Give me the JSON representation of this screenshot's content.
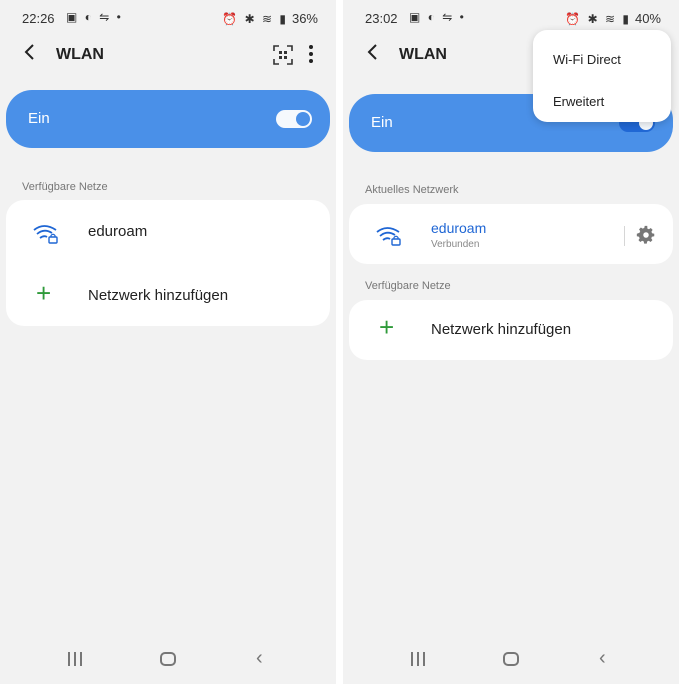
{
  "left": {
    "status": {
      "time": "22:26",
      "left_icons": "▣ ◐ ⇋ •",
      "right_icons": "⏰ ✱ ≋ ▮",
      "battery": "36%"
    },
    "appbar": {
      "title": "WLAN",
      "back_icon": "chevron-left-icon",
      "qr_icon": "qr-scan-icon",
      "more_icon": "more-vert-icon"
    },
    "wifi_toggle": {
      "label": "Ein",
      "on": true
    },
    "available": {
      "label": "Verfügbare Netze",
      "networks": [
        {
          "name": "eduroam",
          "icon": "wifi-lock-icon"
        }
      ],
      "add_label": "Netzwerk hinzufügen"
    },
    "nav": {
      "recents": "recents-icon",
      "home": "home-icon",
      "back": "back-icon"
    }
  },
  "right": {
    "status": {
      "time": "23:02",
      "left_icons": "▣ ◐ ⇋ •",
      "right_icons": "⏰ ✱ ≋ ▮",
      "battery": "40%"
    },
    "appbar": {
      "title": "WLAN",
      "back_icon": "chevron-left-icon"
    },
    "menu": {
      "items": [
        "Wi-Fi Direct",
        "Erweitert"
      ]
    },
    "wifi_toggle": {
      "label": "Ein",
      "on": true
    },
    "current": {
      "label": "Aktuelles Netzwerk",
      "network": {
        "name": "eduroam",
        "status": "Verbunden",
        "icon": "wifi-lock-icon",
        "settings_icon": "gear-icon"
      }
    },
    "available": {
      "label": "Verfügbare Netze",
      "add_label": "Netzwerk hinzufügen"
    },
    "nav": {
      "recents": "recents-icon",
      "home": "home-icon",
      "back": "back-icon"
    }
  },
  "colors": {
    "accent": "#4a90e8",
    "link": "#1f66d4",
    "add": "#2f9a3a",
    "background": "#f2f2f2"
  }
}
